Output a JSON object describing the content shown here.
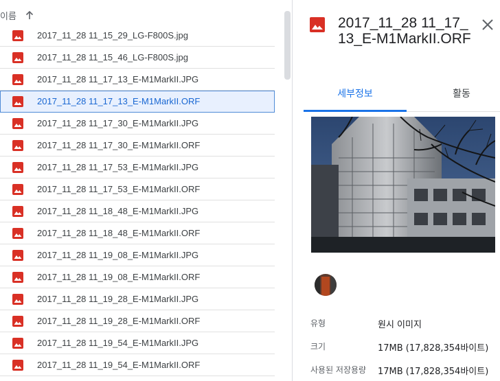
{
  "list": {
    "sort_label": "이름",
    "selected_index": 3,
    "files": [
      "2017_11_28 11_15_29_LG-F800S.jpg",
      "2017_11_28 11_15_46_LG-F800S.jpg",
      "2017_11_28 11_17_13_E-M1MarkII.JPG",
      "2017_11_28 11_17_13_E-M1MarkII.ORF",
      "2017_11_28 11_17_30_E-M1MarkII.JPG",
      "2017_11_28 11_17_30_E-M1MarkII.ORF",
      "2017_11_28 11_17_53_E-M1MarkII.JPG",
      "2017_11_28 11_17_53_E-M1MarkII.ORF",
      "2017_11_28 11_18_48_E-M1MarkII.JPG",
      "2017_11_28 11_18_48_E-M1MarkII.ORF",
      "2017_11_28 11_19_08_E-M1MarkII.JPG",
      "2017_11_28 11_19_08_E-M1MarkII.ORF",
      "2017_11_28 11_19_28_E-M1MarkII.JPG",
      "2017_11_28 11_19_28_E-M1MarkII.ORF",
      "2017_11_28 11_19_54_E-M1MarkII.JPG",
      "2017_11_28 11_19_54_E-M1MarkII.ORF"
    ]
  },
  "details": {
    "title": "2017_11_28 11_17_13_E-M1MarkII.ORF",
    "tabs": {
      "details": "세부정보",
      "activity": "활동"
    },
    "properties": [
      {
        "key": "유형",
        "value": "원시 이미지"
      },
      {
        "key": "크기",
        "value": "17MB (17,828,354바이트)"
      },
      {
        "key": "사용된 저장용량",
        "value": "17MB (17,828,354바이트)"
      }
    ]
  },
  "icons": {
    "file": "image-file-icon",
    "sort": "arrow-up-icon",
    "close": "close-icon"
  },
  "colors": {
    "image_icon": "#d93025",
    "accent": "#1a73e8",
    "selected_bg": "#e8f0fe",
    "selected_border": "#4e8ad6"
  }
}
